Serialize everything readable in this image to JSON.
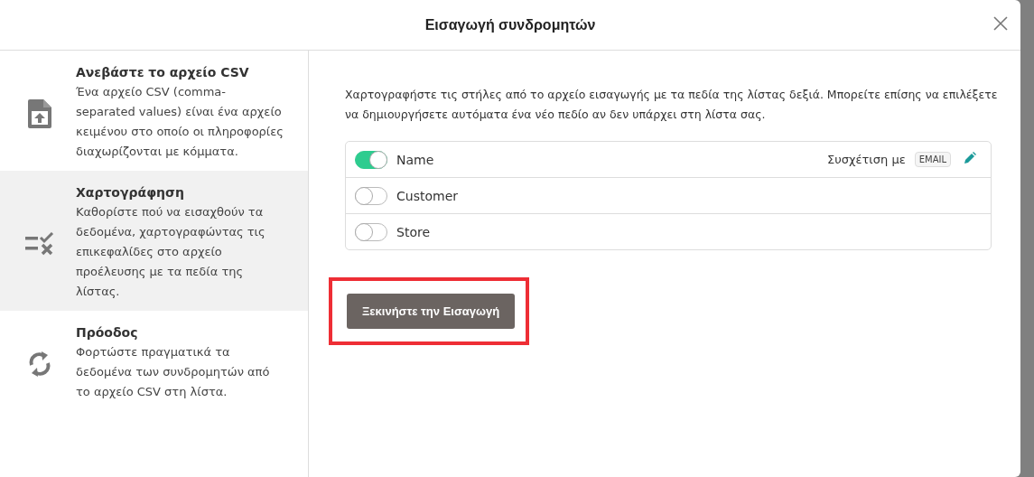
{
  "dialog": {
    "title": "Εισαγωγή συνδρομητών"
  },
  "steps": [
    {
      "kind": "upload",
      "title": "Ανεβάστε το αρχείο CSV",
      "description": "Ένα αρχείο CSV (comma-separated values) είναι ένα αρχείο κειμένου στο οποίο οι πληροφορίες διαχωρίζονται με κόμματα.",
      "selected": false
    },
    {
      "kind": "mapping",
      "title": "Χαρτογράφηση",
      "description": "Καθορίστε πού να εισαχθούν τα δεδομένα, χαρτογραφώντας τις επικεφαλίδες στο αρχείο προέλευσης με τα πεδία της λίστας.",
      "selected": true
    },
    {
      "kind": "progress",
      "title": "Πρόοδος",
      "description": "Φορτώστε πραγματικά τα δεδομένα των συνδρομητών από το αρχείο CSV στη λίστα.",
      "selected": false
    }
  ],
  "instructions": "Χαρτογραφήστε τις στήλες από το αρχείο εισαγωγής με τα πεδία της λίστας δεξιά. Μπορείτε επίσης να επιλέξετε να δημιουργήσετε αυτόματα ένα νέο πεδίο αν δεν υπάρχει στη λίστα σας.",
  "columns": [
    {
      "name": "Name",
      "on": true,
      "mapping_label": "Συσχέτιση με",
      "mapping_field": "EMAIL"
    },
    {
      "name": "Customer",
      "on": false
    },
    {
      "name": "Store",
      "on": false
    }
  ],
  "start_button": {
    "label": "Ξεκινήστε την Εισαγωγή",
    "highlighted": true
  }
}
